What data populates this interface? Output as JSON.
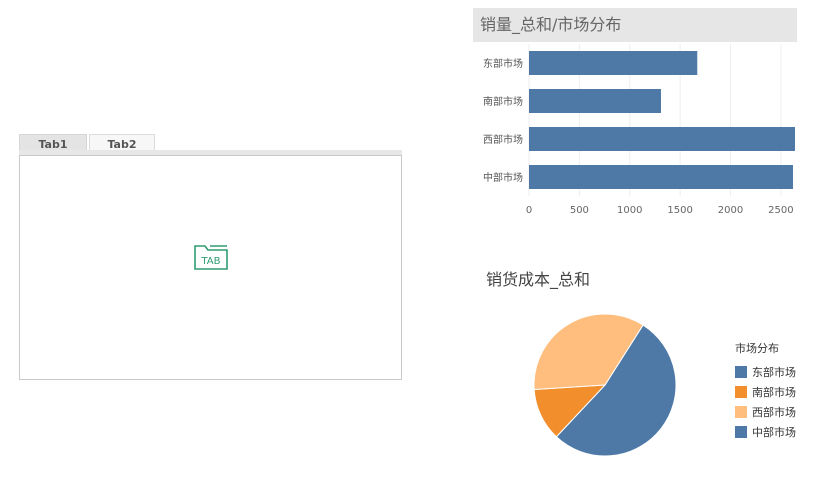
{
  "tabs": [
    {
      "label": "Tab1",
      "active": true
    },
    {
      "label": "Tab2",
      "active": false
    }
  ],
  "tab_icon": {
    "name": "tab-icon",
    "text": "TAB",
    "color": "#2e9c72"
  },
  "colors": {
    "blue": "#4e79a7",
    "orange": "#f28e2b",
    "light_orange": "#ffbe7d",
    "title_bg": "#e6e6e6"
  },
  "chart_data": [
    {
      "type": "bar",
      "orientation": "horizontal",
      "title": "销量_总和/市场分布",
      "categories": [
        "东部市场",
        "南部市场",
        "西部市场",
        "中部市场"
      ],
      "values": [
        1670,
        1310,
        2640,
        2620
      ],
      "xticks": [
        0,
        500,
        1000,
        1500,
        2000,
        2500
      ],
      "xlim": [
        0,
        2640
      ],
      "color": "#4e79a7",
      "grid": true
    },
    {
      "type": "pie",
      "title": "销货成本_总和",
      "legend_title": "市场分布",
      "legend_position": "right",
      "labels": [
        "东部市场",
        "南部市场",
        "西部市场",
        "中部市场"
      ],
      "values": [
        0,
        12,
        35,
        53
      ],
      "colors": [
        "#4e79a7",
        "#f28e2b",
        "#ffbe7d",
        "#4e79a7"
      ]
    }
  ]
}
